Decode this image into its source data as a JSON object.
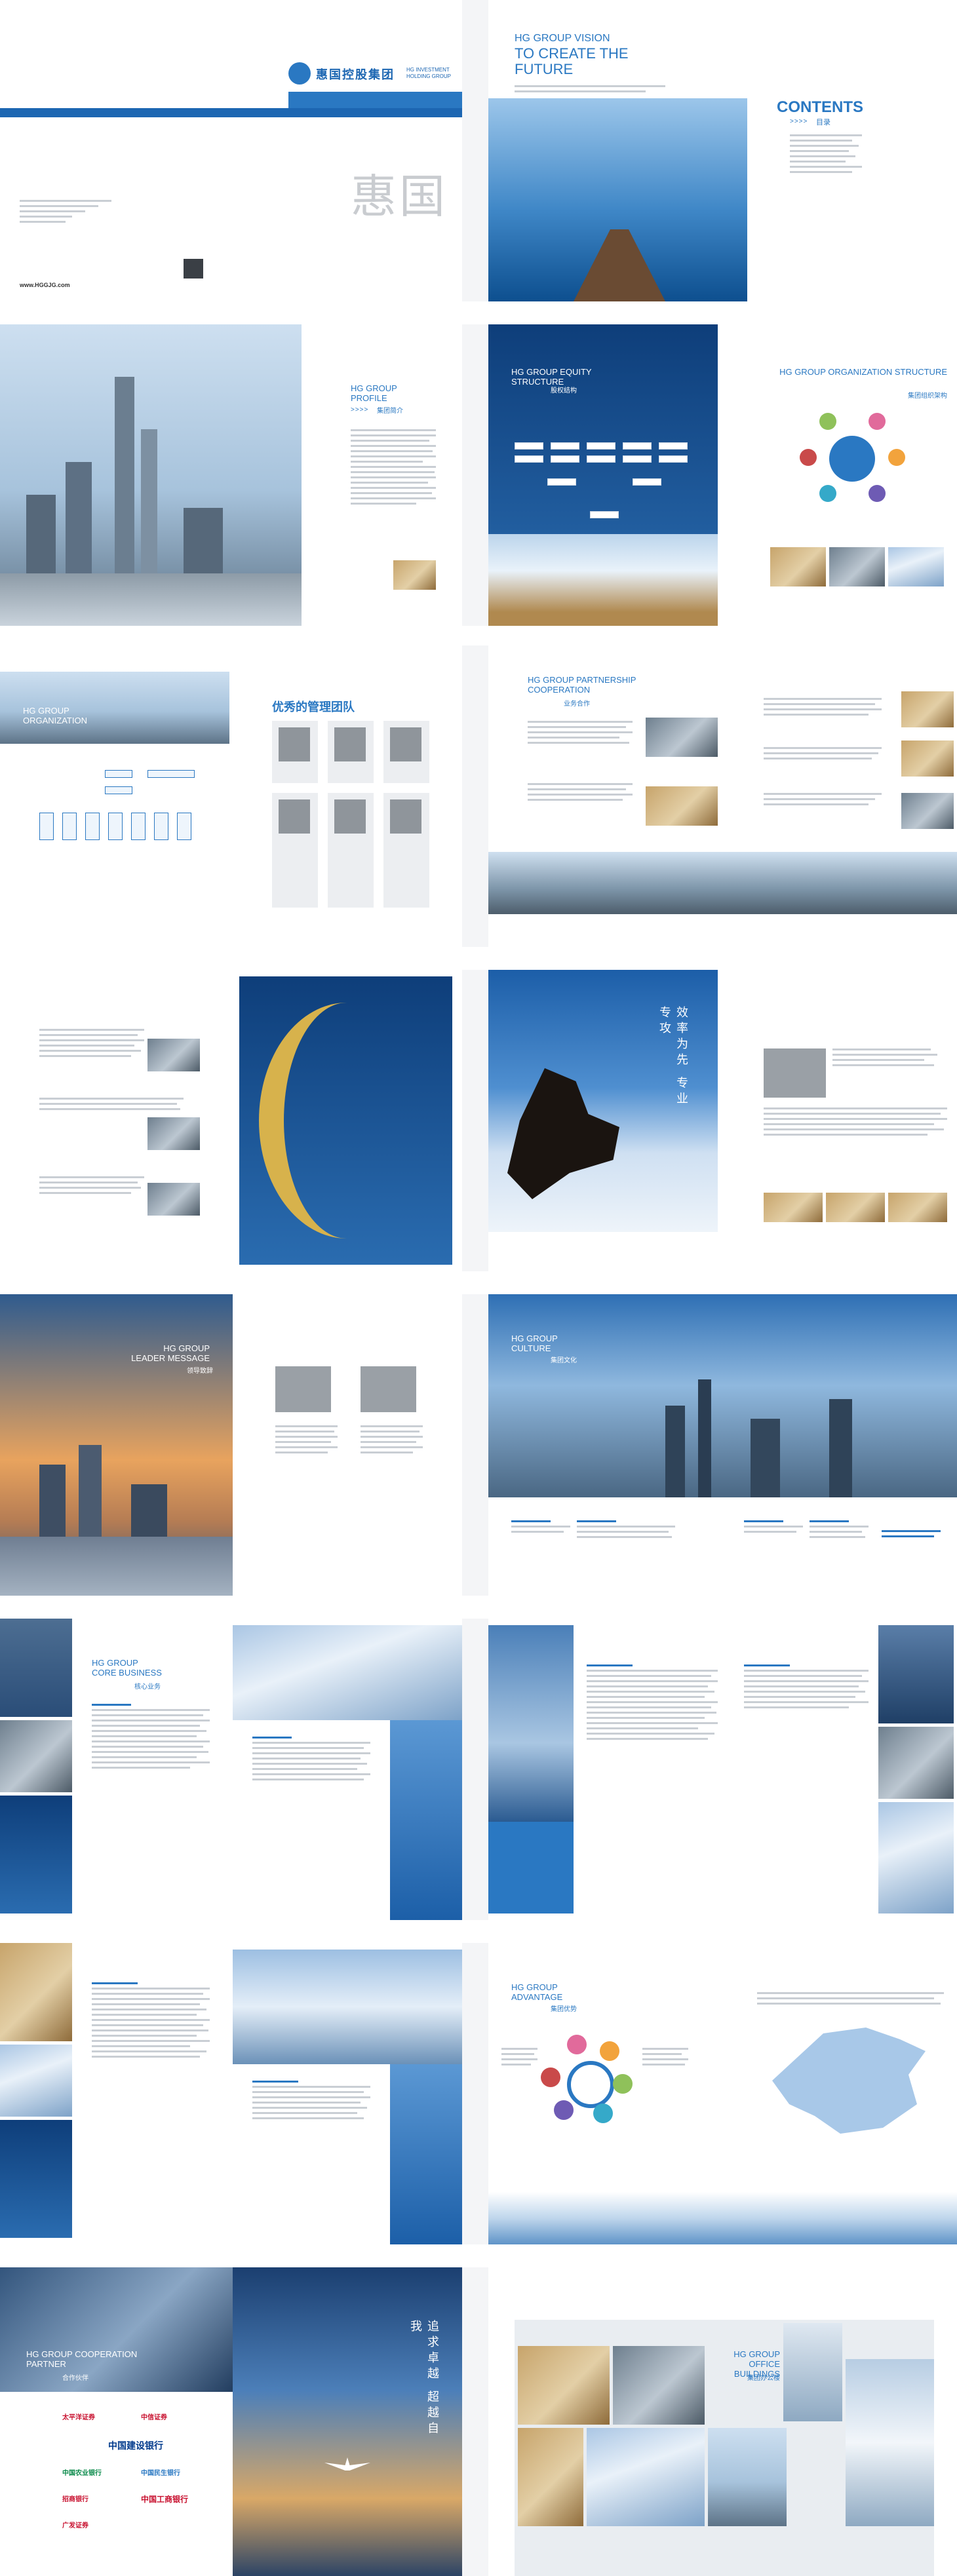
{
  "cover": {
    "logo_text": "HG INVESTMENT HOLDING GROUP",
    "brand_cn": "惠国控股集团",
    "vision_line1": "HG GROUP VISION",
    "vision_line2": "TO CREATE THE FUTURE",
    "contents": "CONTENTS",
    "contents_cn": "目录",
    "seal": "惠国",
    "website": "www.HGGJG.com"
  },
  "sections": {
    "profile": "HG GROUP PROFILE",
    "profile_cn": "集团简介",
    "equity": "HG GROUP EQUITY STRUCTURE",
    "equity_cn": "股权结构",
    "organization": "HG GROUP ORGANIZATION STRUCTURE",
    "organization_cn": "集团组织架构",
    "org_left": "HG GROUP ORGANIZATION",
    "team_cn": "优秀的管理团队",
    "partnership": "HG GROUP PARTNERSHIP COOPERATION",
    "partnership_cn": "业务合作",
    "leader": "HG GROUP LEADER MESSAGE",
    "leader_cn": "领导致辞",
    "culture": "HG GROUP CULTURE",
    "culture_cn": "集团文化",
    "core": "HG GROUP CORE BUSINESS",
    "core_cn": "核心业务",
    "advantage": "HG GROUP ADVANTAGE",
    "advantage_cn": "集团优势",
    "partner": "HG GROUP COOPERATION PARTNER",
    "partner_cn": "合作伙伴",
    "office": "HG GROUP OFFICE BUILDINGS",
    "office_cn": "集团办公楼"
  },
  "slogans": {
    "horse": "效率为先 专业专攻",
    "sea": "追求卓越 超越自我"
  },
  "partners": [
    "太平洋证券",
    "中信证券",
    "中国建设银行",
    "中国农业银行",
    "中国民生银行",
    "招商银行",
    "中国工商银行",
    "广发证券"
  ],
  "arrows": ">>>>"
}
